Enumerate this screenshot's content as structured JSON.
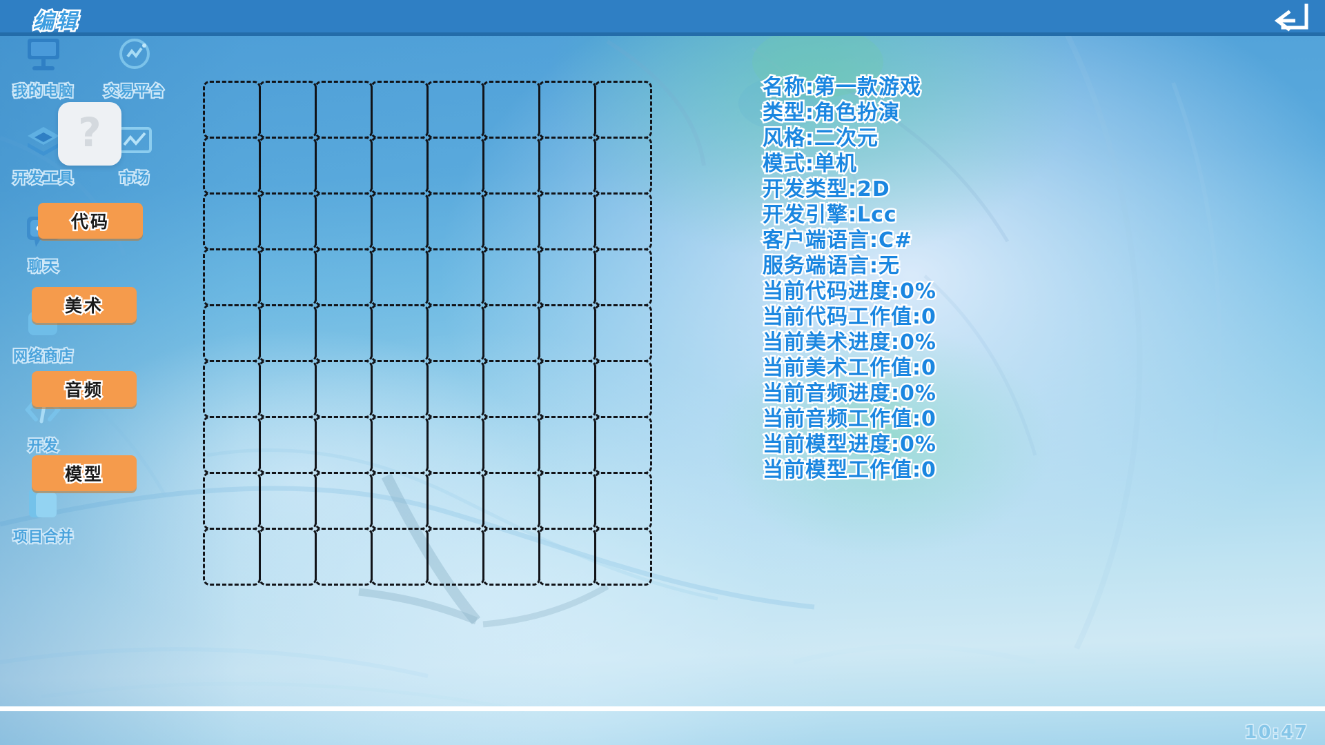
{
  "titlebar": {
    "title": "编辑",
    "back_icon": "back-arrow-icon"
  },
  "sidebar": {
    "items": [
      {
        "label": "我的电脑",
        "icon": "monitor-icon"
      },
      {
        "label": "交易平台",
        "icon": "chart-circle-icon"
      },
      {
        "label": "开发工具",
        "icon": "layers-icon"
      },
      {
        "label": "市场",
        "icon": "trend-window-icon"
      },
      {
        "label": "聊天",
        "icon": "chat-bubble-icon"
      },
      {
        "label": "网络商店",
        "icon": "shop-bag-icon"
      },
      {
        "label": "开发",
        "icon": "code-icon"
      },
      {
        "label": "项目合并",
        "icon": "merge-folder-icon"
      }
    ],
    "unknown_tile": {
      "name": "unknown-tile",
      "glyph": "?"
    }
  },
  "actions": {
    "buttons": [
      {
        "label": "代码",
        "name": "code-button"
      },
      {
        "label": "美术",
        "name": "art-button"
      },
      {
        "label": "音频",
        "name": "audio-button"
      },
      {
        "label": "模型",
        "name": "model-button"
      }
    ],
    "accent_color": "#f59b4c"
  },
  "grid": {
    "columns": 8,
    "rows": 9,
    "cell_size": 81,
    "border_style": "dashed",
    "border_color": "#111318"
  },
  "info": {
    "lines": [
      "名称:第一款游戏",
      "类型:角色扮演",
      "风格:二次元",
      "模式:单机",
      "开发类型:2D",
      "开发引擎:Lcc",
      "客户端语言:C#",
      "服务端语言:无",
      "当前代码进度:0%",
      "当前代码工作值:0",
      "当前美术进度:0%",
      "当前美术工作值:0",
      "当前音频进度:0%",
      "当前音频工作值:0",
      "当前模型进度:0%",
      "当前模型工作值:0"
    ],
    "text_color": "#1a86e0"
  },
  "bottombar": {
    "clock": "10:47"
  }
}
